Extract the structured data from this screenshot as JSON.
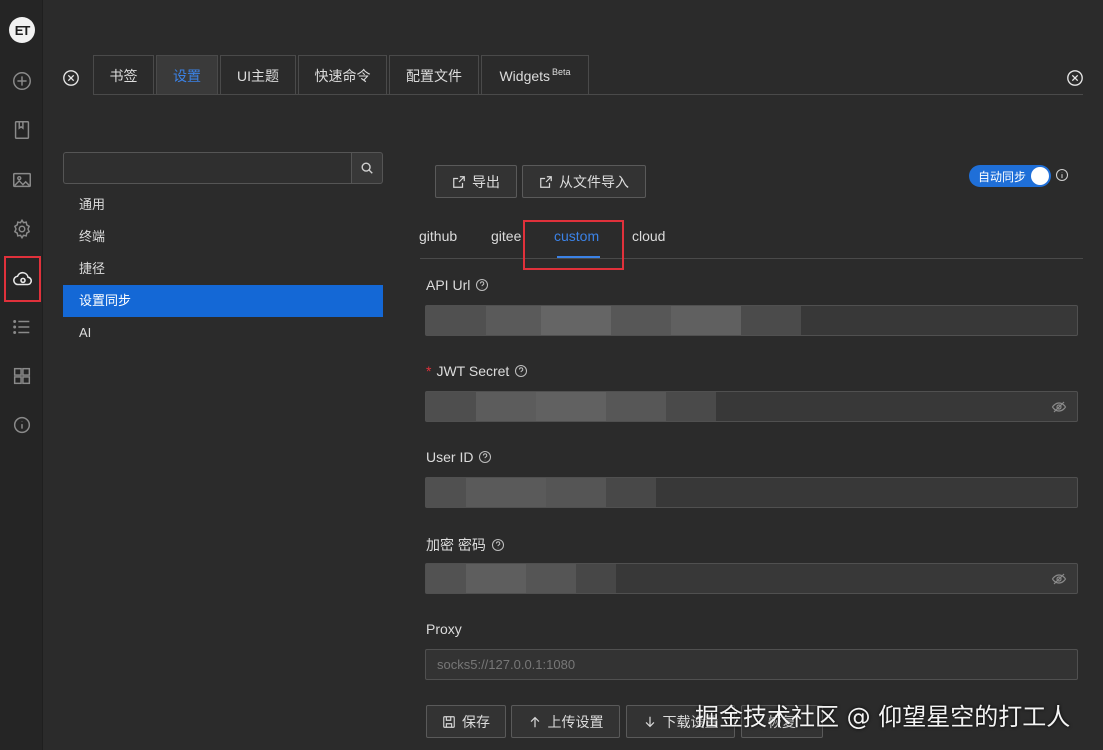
{
  "activity_bar": {
    "logo": "ET",
    "icons": [
      "add-icon",
      "bookmark-icon",
      "image-icon",
      "gear-icon",
      "cloud-sync-icon",
      "list-icon",
      "grid-icon",
      "info-icon"
    ]
  },
  "tabs": [
    {
      "label": "书签"
    },
    {
      "label": "设置"
    },
    {
      "label": "UI主题"
    },
    {
      "label": "快速命令"
    },
    {
      "label": "配置文件"
    },
    {
      "label": "Widgets",
      "badge": "Beta"
    }
  ],
  "sidebar": {
    "search": {
      "value": "",
      "placeholder": ""
    },
    "items": [
      {
        "label": "通用"
      },
      {
        "label": "终端"
      },
      {
        "label": "捷径"
      },
      {
        "label": "设置同步"
      },
      {
        "label": "AI"
      }
    ]
  },
  "toolbar": {
    "export_label": "导出",
    "import_label": "从文件导入",
    "auto_sync_label": "自动同步",
    "auto_sync_on": true
  },
  "sync_tabs": [
    {
      "label": "github"
    },
    {
      "label": "gitee"
    },
    {
      "label": "custom"
    },
    {
      "label": "cloud"
    }
  ],
  "form": {
    "api_url_label": "API Url",
    "jwt_label": "JWT Secret",
    "jwt_required_mark": "*",
    "user_id_label": "User ID",
    "encrypt_label": "加密 密码",
    "proxy_label": "Proxy",
    "proxy_placeholder": "socks5://127.0.0.1:1080"
  },
  "actions": {
    "save_label": "保存",
    "upload_label": "上传设置",
    "download_label": "下载设置",
    "restore_label": "恢复"
  },
  "watermark": "掘金技术社区 @ 仰望星空的打工人",
  "colors": {
    "accent": "#1468d6",
    "highlight": "#e0313b",
    "background": "#2b2b2b"
  }
}
